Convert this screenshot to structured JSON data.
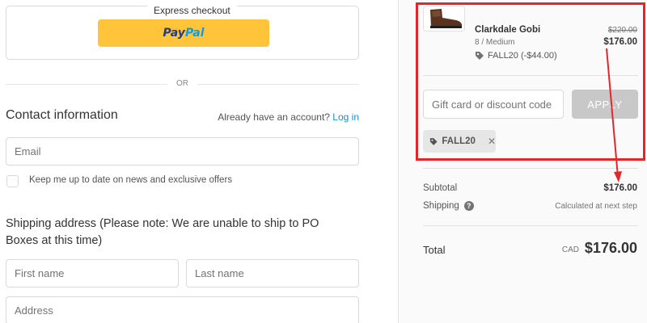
{
  "express": {
    "title": "Express checkout",
    "paypal_pay": "Pay",
    "paypal_pal": "Pal"
  },
  "divider_or": "OR",
  "contact": {
    "title": "Contact information",
    "have_account": "Already have an account? ",
    "login_link": "Log in",
    "email_placeholder": "Email",
    "newsletter_label": "Keep me up to date on news and exclusive offers",
    "newsletter_checked": false
  },
  "shipping": {
    "title": "Shipping address (Please note: We are unable to ship to PO Boxes at this time)",
    "first_name_placeholder": "First name",
    "last_name_placeholder": "Last name",
    "address_placeholder": "Address"
  },
  "summary": {
    "product": {
      "name": "Clarkdale Gobi",
      "variant": "8 / Medium",
      "discount": "FALL20 (-$44.00)",
      "original_price": "$220.00",
      "price": "$176.00"
    },
    "discount_input_placeholder": "Gift card or discount code",
    "apply_label": "APPLY",
    "applied_code": "FALL20",
    "subtotal_label": "Subtotal",
    "subtotal_value": "$176.00",
    "shipping_label": "Shipping",
    "shipping_value": "Calculated at next step",
    "total_label": "Total",
    "total_currency": "CAD",
    "total_value": "$176.00"
  },
  "colors": {
    "highlight": "#e4262a",
    "link": "#1990c6",
    "paypal_yellow": "#ffc439"
  },
  "icons": [
    "tag-icon",
    "close-icon",
    "help-icon",
    "paypal-logo"
  ]
}
